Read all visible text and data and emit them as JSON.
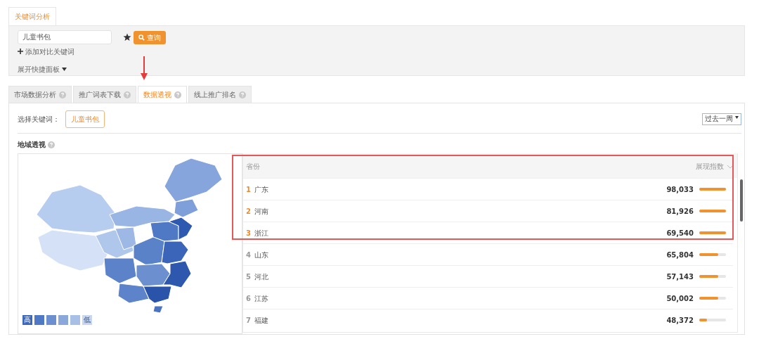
{
  "page_tab": {
    "label": "关键词分析",
    "selected": true
  },
  "search": {
    "value": "儿童书包",
    "button": "查询",
    "add_compare": "添加对比关键词",
    "expand_panel": "展开快捷面板"
  },
  "tabs": [
    {
      "label": "市场数据分析",
      "selected": false
    },
    {
      "label": "推广词表下载",
      "selected": false
    },
    {
      "label": "数据透视",
      "selected": true
    },
    {
      "label": "线上推广排名",
      "selected": false
    }
  ],
  "keyword_filter": {
    "label": "选择关键词：",
    "chip": "儿童书包"
  },
  "period": {
    "value": "过去一周"
  },
  "section_title": "地域透视",
  "legend": [
    {
      "label": "高",
      "color": "#3c68b9"
    },
    {
      "color": "#4f79c4"
    },
    {
      "color": "#6b8fcf"
    },
    {
      "color": "#8aa8da"
    },
    {
      "color": "#a9c0e6"
    },
    {
      "label": "低",
      "color": "#c9d8f0"
    }
  ],
  "table": {
    "columns": [
      "省份",
      "展现指数"
    ],
    "rows": [
      {
        "rank": "1",
        "province": "广东",
        "value": "98,033",
        "level": 1,
        "top": true
      },
      {
        "rank": "2",
        "province": "河南",
        "value": "81,926",
        "level": 1,
        "top": true
      },
      {
        "rank": "3",
        "province": "浙江",
        "value": "69,540",
        "level": 1,
        "top": true
      },
      {
        "rank": "4",
        "province": "山东",
        "value": "65,804",
        "level": 0.7,
        "top": false
      },
      {
        "rank": "5",
        "province": "河北",
        "value": "57,143",
        "level": 0.7,
        "top": false
      },
      {
        "rank": "6",
        "province": "江苏",
        "value": "50,002",
        "level": 0.7,
        "top": false
      },
      {
        "rank": "7",
        "province": "福建",
        "value": "48,372",
        "level": 0.3,
        "top": false
      }
    ]
  },
  "annotations": {
    "arrow": true,
    "highlight_box": true
  }
}
